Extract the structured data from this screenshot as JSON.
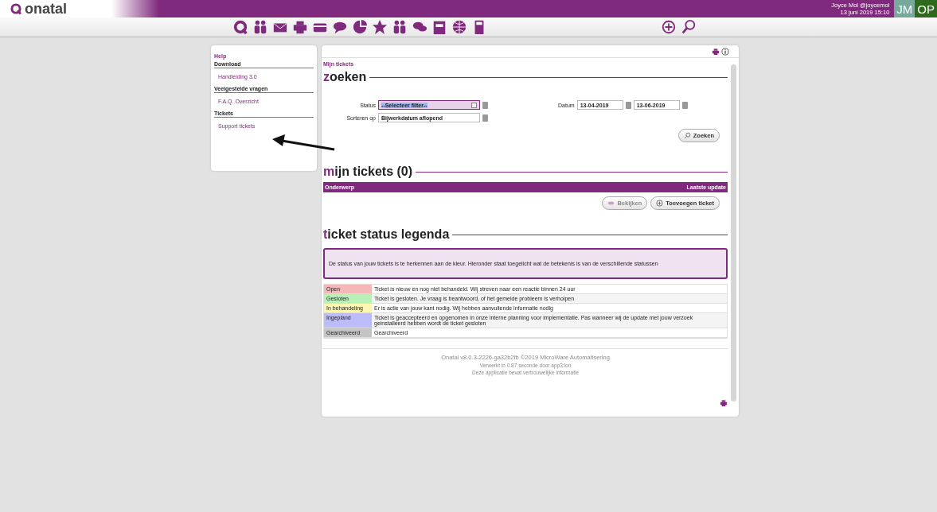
{
  "header": {
    "logo_text": "onatal",
    "user": "Joyce Mol @joycemol",
    "datetime": "13 juni 2019 15:10",
    "avatars": [
      {
        "text": "JM",
        "color": "#77aa9c"
      },
      {
        "text": "OP",
        "color": "#2f6a1c"
      }
    ]
  },
  "sidebar": {
    "title": "Help",
    "groups": [
      {
        "heading": "Download",
        "links": [
          "Handleiding 3.0"
        ]
      },
      {
        "heading": "Veelgestelde vragen",
        "links": [
          "F.A.Q. Overzicht"
        ]
      },
      {
        "heading": "Tickets",
        "links": [
          "Support tickets"
        ]
      }
    ]
  },
  "main": {
    "breadcrumb": "Mijn tickets",
    "search": {
      "heading": "zoeken",
      "status_label": "Status",
      "status_value": "--Selecteer filter--",
      "sort_label": "Sorteren op",
      "sort_value": "Bijwerkdatum aflopend",
      "date_label": "Datum",
      "date_from": "13-04-2019",
      "date_to": "13-06-2019",
      "button": "Zoeken"
    },
    "tickets": {
      "heading": "mijn tickets (0)",
      "columns": [
        "Onderwerp",
        "Laatste update"
      ],
      "buttons": [
        {
          "label": "Bekijken",
          "disabled": true,
          "kind": "view"
        },
        {
          "label": "Toevoegen ticket",
          "disabled": false,
          "kind": "add"
        }
      ]
    },
    "legend": {
      "heading": "ticket status legenda",
      "info": "De status van jouw tickets is te herkennen aan de kleur. Hieronder staat toegelicht wat de betekenis is van de verschillende statussen",
      "rows": [
        {
          "status": "Open",
          "color": "#f4b8b8",
          "description": "Ticket is nieuw en nog niet behandeld. Wij streven naar een reactie binnen 24 uur"
        },
        {
          "status": "Gesloten",
          "color": "#b8f0b8",
          "description": "Ticket is gesloten. Je vraag is beantwoord, of het gemelde probleem is verholpen"
        },
        {
          "status": "In behandeling",
          "color": "#fbf7b0",
          "description": "Er is actie van jouw kant nodig. Wij hebben aanvullende informatie nodig"
        },
        {
          "status": "Ingepland",
          "color": "#bcbcf8",
          "description": "Ticket is geaccepteerd en opgenomen in onze interne planning voor implementatie. Pas wanneer wij de update met jouw verzoek geinstalleerd hebben wordt de ticket gesloten"
        },
        {
          "status": "Gearchiveerd",
          "color": "#c4c4c4",
          "description": "Gearchiveerd"
        }
      ]
    },
    "footer": [
      "Onatal v8.0.3-2226-ga32b2fb ©2019 MicroWare Automatisering",
      "Verwerkt in 0.87 seconde door app3:lon",
      "Deze applicatie bevat vertrouwelijke informatie"
    ]
  }
}
